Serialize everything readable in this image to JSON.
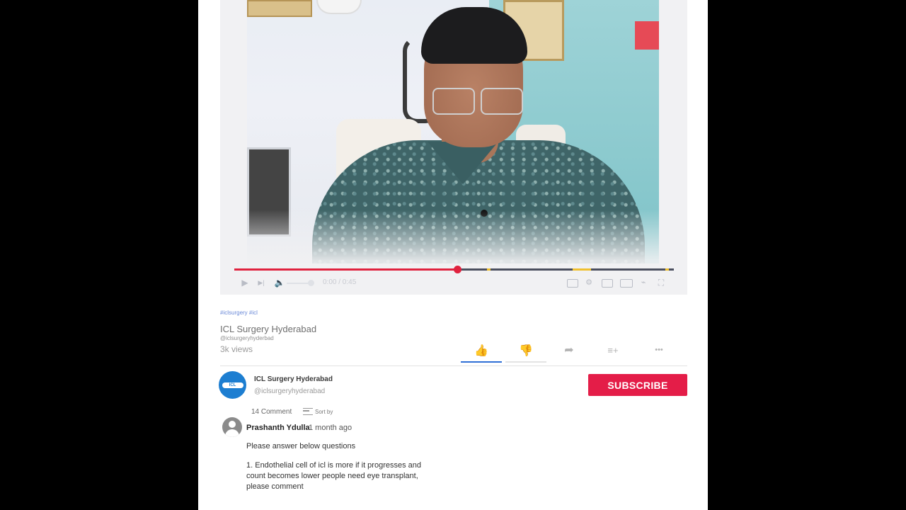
{
  "video": {
    "time_display": "0:00 / 0:45",
    "progress_fraction": 0.507,
    "chapter_marks": [
      0.575,
      0.77,
      0.8,
      0.98
    ]
  },
  "info": {
    "hashtags": "#iclsurgery #icl",
    "title": "ICL Surgery Hyderabad",
    "handle": "@iclsurgeryhyderbad",
    "views": "3k views"
  },
  "actions": [
    {
      "name": "like-button",
      "icon": "thumbs-up-icon",
      "glyph": "👍"
    },
    {
      "name": "dislike-button",
      "icon": "thumbs-down-icon",
      "glyph": "👎"
    },
    {
      "name": "share-button",
      "icon": "share-icon",
      "glyph": "➦"
    },
    {
      "name": "save-to-playlist-button",
      "icon": "playlist-add-icon",
      "glyph": "≡+"
    },
    {
      "name": "more-button",
      "icon": "more-dots-icon",
      "glyph": "•••"
    }
  ],
  "channel": {
    "name": "ICL Surgery Hyderabad",
    "handle": "@iclsurgeryhyderabad",
    "logo_text": "ICL",
    "subscribe_label": "SUBSCRIBE"
  },
  "comments": {
    "count_label": "14 Comment",
    "sort_label": "Sort by",
    "first": {
      "author": "Prashanth Ydulla",
      "time": "1 month ago",
      "line1": "Please answer below questions",
      "line2": "1.  Endothelial cell of icl is more if it progresses and count becomes lower people need eye transplant, please comment"
    }
  },
  "colors": {
    "accent_red": "#e41d48",
    "progress_red": "#e0223e",
    "link_blue": "#2f6fd6"
  }
}
